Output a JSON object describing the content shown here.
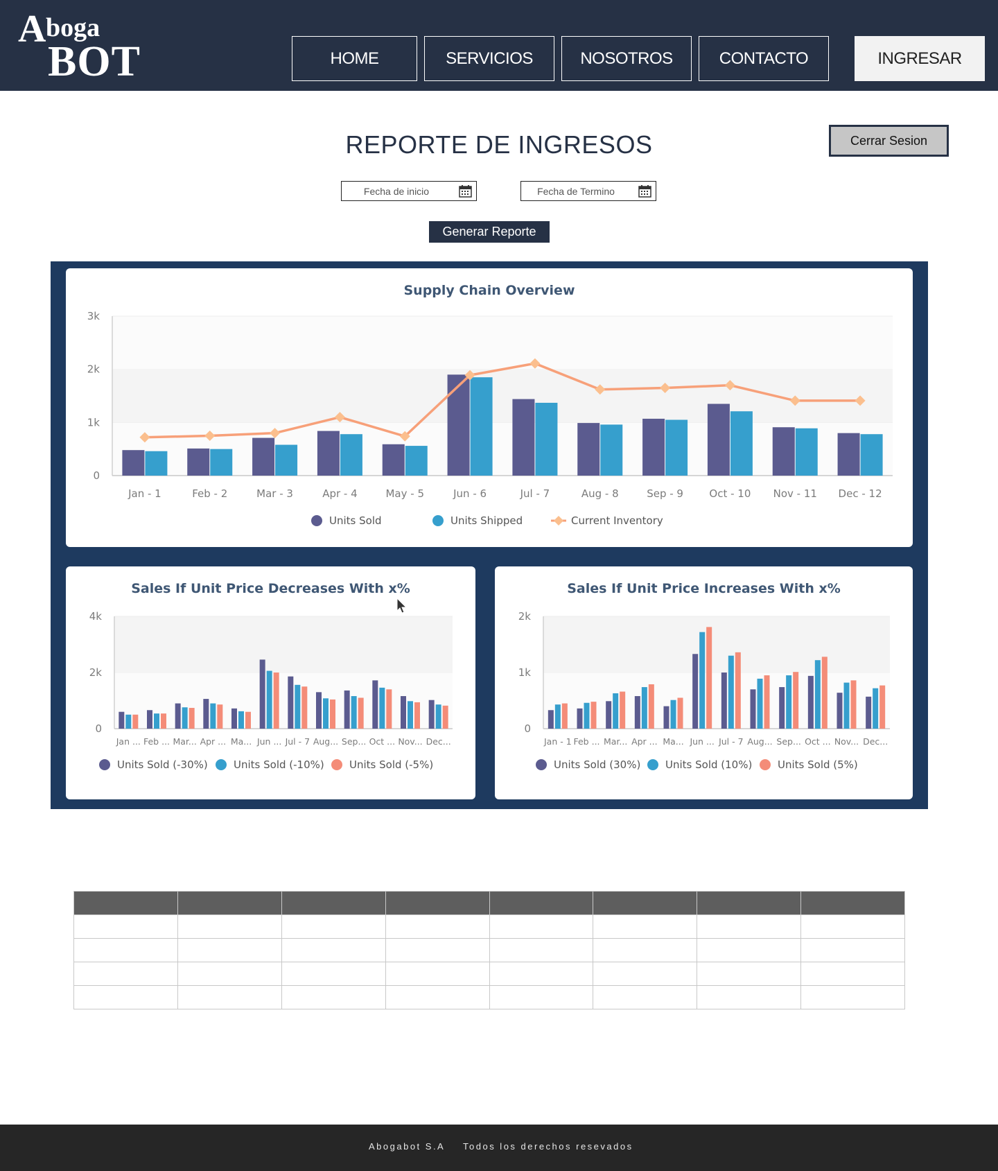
{
  "header": {
    "logo": {
      "line1": "A",
      "line2": "boga",
      "line3": "BOT"
    },
    "nav": [
      "HOME",
      "SERVICIOS",
      "NOSOTROS",
      "CONTACTO"
    ],
    "login_label": "INGRESAR"
  },
  "main": {
    "title": "REPORTE DE INGRESOS",
    "logout_label": "Cerrar Sesion",
    "start_date_placeholder": "Fecha de inicio",
    "end_date_placeholder": "Fecha de Termino",
    "generate_label": "Generar Reporte"
  },
  "colors": {
    "header_bg": "#263145",
    "dashboard_bg": "#1e3a5f",
    "series_purple": "#5b5b8f",
    "series_blue": "#369fcd",
    "series_salmon": "#f48c78",
    "inventory_line": "#f7a079",
    "footer_bg": "#262626"
  },
  "chart_data": [
    {
      "type": "bar",
      "title": "Supply Chain Overview",
      "categories": [
        "Jan - 1",
        "Feb - 2",
        "Mar - 3",
        "Apr - 4",
        "May - 5",
        "Jun - 6",
        "Jul - 7",
        "Aug - 8",
        "Sep - 9",
        "Oct - 10",
        "Nov - 11",
        "Dec - 12"
      ],
      "yticks": [
        "0",
        "1k",
        "2k",
        "3k"
      ],
      "ylim": [
        0,
        3000
      ],
      "series": [
        {
          "name": "Units Sold",
          "type": "bar",
          "values": [
            480,
            510,
            710,
            840,
            590,
            1900,
            1440,
            990,
            1070,
            1350,
            910,
            800
          ]
        },
        {
          "name": "Units Shipped",
          "type": "bar",
          "values": [
            460,
            500,
            580,
            780,
            560,
            1850,
            1370,
            960,
            1050,
            1210,
            890,
            780
          ]
        },
        {
          "name": "Current Inventory",
          "type": "line",
          "values": [
            720,
            750,
            800,
            1100,
            740,
            1890,
            2110,
            1620,
            1650,
            1700,
            1410,
            1410
          ]
        }
      ],
      "legend": "bottom",
      "grid": true
    },
    {
      "type": "bar",
      "title": "Sales If Unit Price Decreases With x%",
      "categories": [
        "Jan ...",
        "Feb ...",
        "Mar...",
        "Apr ...",
        "Ma...",
        "Jun ...",
        "Jul - 7",
        "Aug...",
        "Sep...",
        "Oct ...",
        "Nov...",
        "Dec..."
      ],
      "yticks": [
        "0",
        "2k",
        "4k"
      ],
      "ylim": [
        0,
        4000
      ],
      "series": [
        {
          "name": "Units Sold (-30%)",
          "values": [
            600,
            660,
            900,
            1060,
            720,
            2460,
            1860,
            1300,
            1360,
            1720,
            1160,
            1020
          ]
        },
        {
          "name": "Units Sold (-10%)",
          "values": [
            500,
            540,
            760,
            900,
            620,
            2060,
            1560,
            1080,
            1160,
            1460,
            980,
            860
          ]
        },
        {
          "name": "Units Sold (-5%)",
          "values": [
            500,
            540,
            740,
            860,
            600,
            2000,
            1500,
            1040,
            1100,
            1400,
            940,
            820
          ]
        }
      ],
      "legend": "bottom",
      "grid": true
    },
    {
      "type": "bar",
      "title": "Sales If Unit Price Increases With x%",
      "categories": [
        "Jan - 1",
        "Feb ...",
        "Mar...",
        "Apr ...",
        "Ma...",
        "Jun ...",
        "Jul - 7",
        "Aug...",
        "Sep...",
        "Oct ...",
        "Nov...",
        "Dec..."
      ],
      "yticks": [
        "0",
        "1k",
        "2k"
      ],
      "ylim": [
        0,
        2000
      ],
      "series": [
        {
          "name": "Units Sold (30%)",
          "values": [
            330,
            360,
            490,
            580,
            400,
            1330,
            1000,
            700,
            740,
            940,
            640,
            570
          ]
        },
        {
          "name": "Units Sold (10%)",
          "values": [
            430,
            460,
            630,
            740,
            510,
            1720,
            1300,
            890,
            950,
            1220,
            820,
            720
          ]
        },
        {
          "name": "Units Sold (5%)",
          "values": [
            450,
            480,
            660,
            790,
            550,
            1810,
            1360,
            950,
            1010,
            1280,
            860,
            770
          ]
        }
      ],
      "legend": "bottom",
      "grid": true
    }
  ],
  "table": {
    "columns": 8,
    "rows": 4
  },
  "footer": {
    "company": "Abogabot S.A",
    "rights": "Todos los derechos resevados"
  }
}
